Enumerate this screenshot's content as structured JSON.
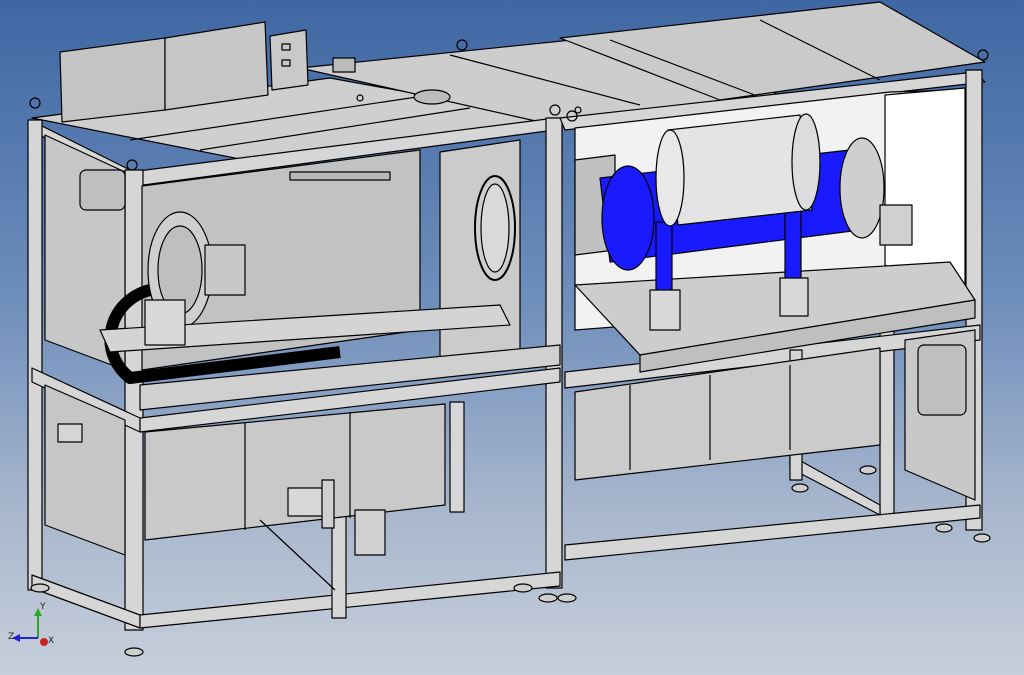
{
  "viewport": {
    "background_top": "#3f67a3",
    "background_bottom": "#c7cfdb"
  },
  "model": {
    "frame_color": "#d2d2d2",
    "panel_color": "#c9c9c9",
    "highlight_color": "#1a1aff",
    "edge_color": "#000000"
  },
  "triad": {
    "x_label": "X",
    "y_label": "Y",
    "z_label": "Z",
    "x_color": "#cc2222",
    "y_color": "#22aa22",
    "z_color": "#2222cc"
  }
}
